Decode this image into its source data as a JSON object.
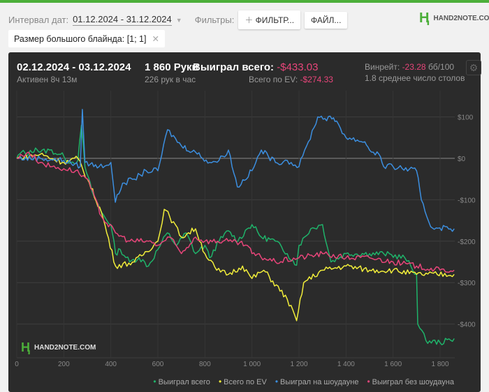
{
  "filters": {
    "date_label": "Интервал дат:",
    "date_value": "01.12.2024 - 31.12.2024",
    "filters_label": "Фильтры:",
    "add_filter": "ФИЛЬТР...",
    "file_button": "ФАЙЛ...",
    "chip": "Размер большого блайнда: [1; 1]"
  },
  "logo": "HAND2NOTE.COM",
  "stats": {
    "period": "02.12.2024 - 03.12.2024",
    "active": "Активен 8ч 13м",
    "hands": "1 860 Руки",
    "hands_per_hour": "226 рук в час",
    "won_label": "Выиграл всего:",
    "won_value": "-$433.03",
    "ev_label": "Всего по EV:",
    "ev_value": "-$274.33",
    "winrate_label": "Винрейт:",
    "winrate_value": "-23.28",
    "winrate_unit": "бб/100",
    "tables": "1.8 среднее число столов"
  },
  "colors": {
    "green": "#1fb36a",
    "yellow": "#f2ee3a",
    "blue": "#3c8fe0",
    "pink": "#e8457a"
  },
  "chart_data": {
    "type": "line",
    "xlabel": "",
    "ylabel": "",
    "xlim": [
      0,
      1860
    ],
    "ylim": [
      -480,
      110
    ],
    "x_ticks": [
      "0",
      "200",
      "400",
      "600",
      "800",
      "1 000",
      "1 200",
      "1 400",
      "1 600",
      "1 800"
    ],
    "x_tick_values": [
      0,
      200,
      400,
      600,
      800,
      1000,
      1200,
      1400,
      1600,
      1800
    ],
    "y_ticks": [
      "$100",
      "$0",
      "-$100",
      "-$200",
      "-$300",
      "-$400"
    ],
    "y_tick_values": [
      100,
      0,
      -100,
      -200,
      -300,
      -400
    ],
    "legend": "bottom-right",
    "series": [
      {
        "name": "Выиграл всего",
        "color": "#1fb36a",
        "points": [
          [
            0,
            0
          ],
          [
            20,
            15
          ],
          [
            50,
            10
          ],
          [
            80,
            25
          ],
          [
            100,
            15
          ],
          [
            140,
            20
          ],
          [
            180,
            10
          ],
          [
            200,
            5
          ],
          [
            230,
            -10
          ],
          [
            260,
            -5
          ],
          [
            275,
            80
          ],
          [
            290,
            -20
          ],
          [
            320,
            -80
          ],
          [
            360,
            -130
          ],
          [
            400,
            -160
          ],
          [
            420,
            -230
          ],
          [
            440,
            -220
          ],
          [
            480,
            -250
          ],
          [
            520,
            -240
          ],
          [
            560,
            -260
          ],
          [
            600,
            -220
          ],
          [
            640,
            -180
          ],
          [
            680,
            -210
          ],
          [
            720,
            -180
          ],
          [
            760,
            -230
          ],
          [
            800,
            -210
          ],
          [
            820,
            -240
          ],
          [
            860,
            -200
          ],
          [
            900,
            -175
          ],
          [
            940,
            -200
          ],
          [
            980,
            -170
          ],
          [
            1000,
            -160
          ],
          [
            1040,
            -190
          ],
          [
            1100,
            -200
          ],
          [
            1150,
            -230
          ],
          [
            1190,
            -258
          ],
          [
            1200,
            -210
          ],
          [
            1250,
            -170
          ],
          [
            1300,
            -160
          ],
          [
            1336,
            -250
          ],
          [
            1400,
            -230
          ],
          [
            1500,
            -230
          ],
          [
            1560,
            -230
          ],
          [
            1650,
            -240
          ],
          [
            1700,
            -280
          ],
          [
            1705,
            -400
          ],
          [
            1740,
            -440
          ],
          [
            1800,
            -445
          ],
          [
            1860,
            -435
          ]
        ]
      },
      {
        "name": "Всего по EV",
        "color": "#f2ee3a",
        "points": [
          [
            0,
            0
          ],
          [
            100,
            10
          ],
          [
            200,
            -10
          ],
          [
            260,
            0
          ],
          [
            300,
            -50
          ],
          [
            360,
            -130
          ],
          [
            420,
            -260
          ],
          [
            500,
            -250
          ],
          [
            600,
            -200
          ],
          [
            627,
            -123
          ],
          [
            650,
            -140
          ],
          [
            700,
            -190
          ],
          [
            760,
            -170
          ],
          [
            800,
            -230
          ],
          [
            850,
            -270
          ],
          [
            900,
            -280
          ],
          [
            960,
            -260
          ],
          [
            1000,
            -290
          ],
          [
            1050,
            -270
          ],
          [
            1150,
            -340
          ],
          [
            1190,
            -392
          ],
          [
            1220,
            -300
          ],
          [
            1300,
            -270
          ],
          [
            1400,
            -260
          ],
          [
            1500,
            -270
          ],
          [
            1600,
            -270
          ],
          [
            1700,
            -280
          ],
          [
            1860,
            -280
          ]
        ]
      },
      {
        "name": "Выиграл на шоудауне",
        "color": "#3c8fe0",
        "points": [
          [
            0,
            0
          ],
          [
            100,
            0
          ],
          [
            200,
            -5
          ],
          [
            270,
            -20
          ],
          [
            279,
            118
          ],
          [
            290,
            -10
          ],
          [
            350,
            -20
          ],
          [
            400,
            -10
          ],
          [
            419,
            -106
          ],
          [
            450,
            -60
          ],
          [
            500,
            -50
          ],
          [
            550,
            -30
          ],
          [
            600,
            -30
          ],
          [
            641,
            69
          ],
          [
            700,
            30
          ],
          [
            760,
            15
          ],
          [
            820,
            -10
          ],
          [
            860,
            -5
          ],
          [
            900,
            20
          ],
          [
            938,
            -69
          ],
          [
            1000,
            -30
          ],
          [
            1040,
            20
          ],
          [
            1100,
            -10
          ],
          [
            1150,
            -5
          ],
          [
            1200,
            -20
          ],
          [
            1240,
            40
          ],
          [
            1280,
            100
          ],
          [
            1340,
            95
          ],
          [
            1360,
            90
          ],
          [
            1400,
            50
          ],
          [
            1480,
            40
          ],
          [
            1500,
            20
          ],
          [
            1540,
            10
          ],
          [
            1560,
            -20
          ],
          [
            1600,
            -20
          ],
          [
            1700,
            -30
          ],
          [
            1720,
            -100
          ],
          [
            1760,
            -165
          ],
          [
            1860,
            -170
          ]
        ]
      },
      {
        "name": "Выиграл без шоудауна",
        "color": "#e8457a",
        "points": [
          [
            0,
            0
          ],
          [
            50,
            15
          ],
          [
            100,
            -10
          ],
          [
            150,
            -20
          ],
          [
            200,
            -25
          ],
          [
            250,
            -30
          ],
          [
            300,
            -50
          ],
          [
            360,
            -140
          ],
          [
            420,
            -180
          ],
          [
            480,
            -200
          ],
          [
            560,
            -200
          ],
          [
            600,
            -210
          ],
          [
            650,
            -190
          ],
          [
            700,
            -230
          ],
          [
            760,
            -190
          ],
          [
            800,
            -200
          ],
          [
            900,
            -200
          ],
          [
            980,
            -210
          ],
          [
            1000,
            -230
          ],
          [
            1100,
            -250
          ],
          [
            1200,
            -240
          ],
          [
            1300,
            -230
          ],
          [
            1400,
            -240
          ],
          [
            1500,
            -240
          ],
          [
            1600,
            -250
          ],
          [
            1700,
            -260
          ],
          [
            1800,
            -270
          ],
          [
            1860,
            -270
          ]
        ]
      }
    ]
  }
}
